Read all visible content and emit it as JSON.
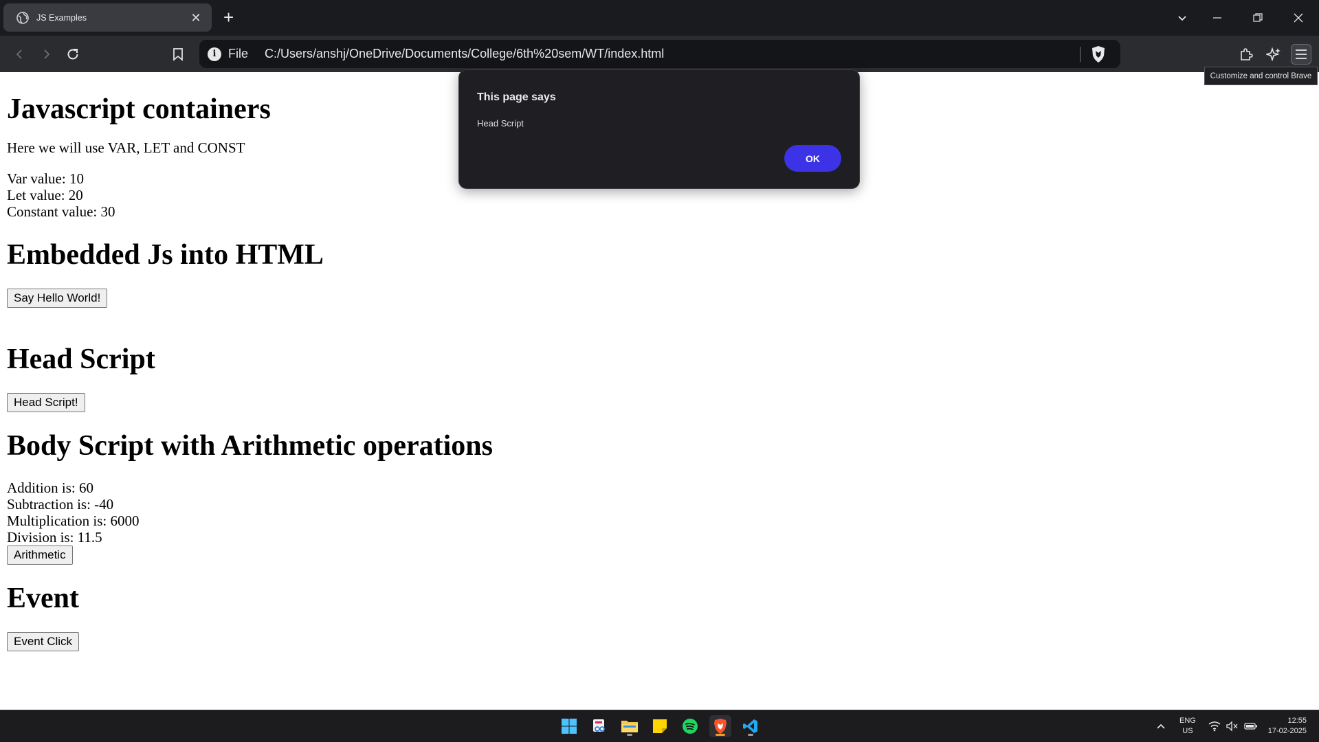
{
  "browser": {
    "tab_title": "JS Examples",
    "new_tab": "+",
    "scheme_label": "File",
    "url": "C:/Users/anshj/OneDrive/Documents/College/6th%20sem/WT/index.html",
    "tooltip": "Customize and control Brave",
    "tab_close": "✕"
  },
  "page": {
    "h_containers": "Javascript containers",
    "intro": "Here we will use VAR, LET and CONST",
    "var_line": "Var value: 10",
    "let_line": "Let value: 20",
    "const_line": "Constant value: 30",
    "h_embedded": "Embedded Js into HTML",
    "btn_hello": "Say Hello World!",
    "h_head": "Head Script",
    "btn_head": "Head Script!",
    "h_body": "Body Script with Arithmetic operations",
    "addition": "Addition is: 60",
    "subtraction": "Subtraction is: -40",
    "multiplication": "Multiplication is: 6000",
    "division": "Division is: 11.5",
    "btn_arith": "Arithmetic",
    "h_event": "Event",
    "btn_event": "Event Click"
  },
  "dialog": {
    "title": "This page says",
    "message": "Head Script",
    "ok": "OK"
  },
  "taskbar": {
    "lang_top": "ENG",
    "lang_bottom": "US",
    "time": "12:55",
    "date": "17-02-2025"
  },
  "colors": {
    "dialog_ok": "#3c33e6",
    "tab_strip": "#1a1b1e",
    "toolbar": "#2b2c30"
  }
}
